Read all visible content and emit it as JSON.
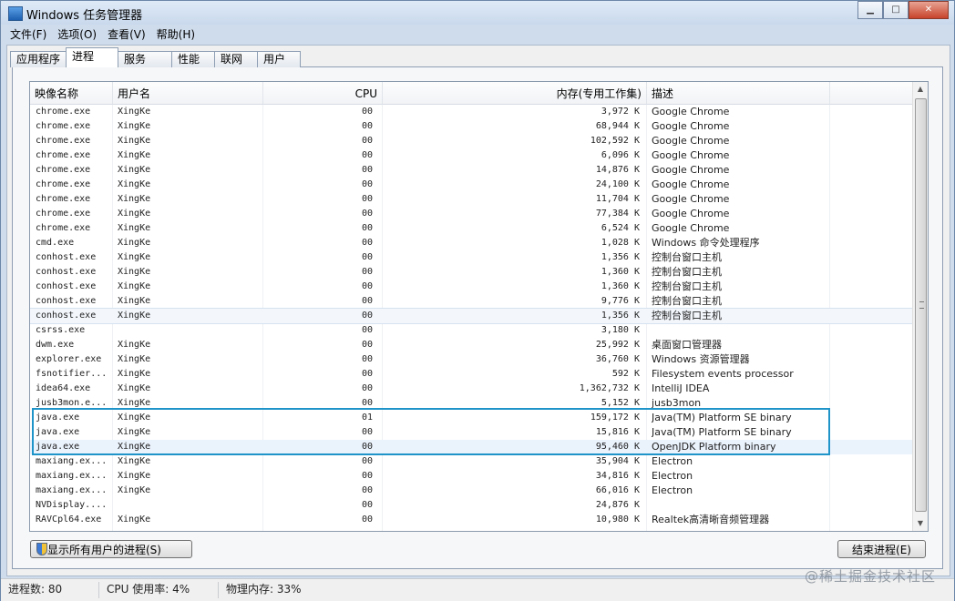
{
  "window": {
    "title": "Windows 任务管理器",
    "min_glyph": "▁",
    "max_glyph": "□",
    "close_glyph": "✕"
  },
  "menu": [
    "文件(F)",
    "选项(O)",
    "查看(V)",
    "帮助(H)"
  ],
  "tabs": [
    "应用程序",
    "进程",
    "服务",
    "性能",
    "联网",
    "用户"
  ],
  "active_tab": 1,
  "columns": {
    "name": "映像名称",
    "user": "用户名",
    "cpu": "CPU",
    "memory": "内存(专用工作集)",
    "desc": "描述"
  },
  "rows": [
    {
      "name": "chrome.exe",
      "user": "XingKe",
      "cpu": "00",
      "mem": "3,972 K",
      "desc": "Google Chrome"
    },
    {
      "name": "chrome.exe",
      "user": "XingKe",
      "cpu": "00",
      "mem": "68,944 K",
      "desc": "Google Chrome"
    },
    {
      "name": "chrome.exe",
      "user": "XingKe",
      "cpu": "00",
      "mem": "102,592 K",
      "desc": "Google Chrome"
    },
    {
      "name": "chrome.exe",
      "user": "XingKe",
      "cpu": "00",
      "mem": "6,096 K",
      "desc": "Google Chrome"
    },
    {
      "name": "chrome.exe",
      "user": "XingKe",
      "cpu": "00",
      "mem": "14,876 K",
      "desc": "Google Chrome"
    },
    {
      "name": "chrome.exe",
      "user": "XingKe",
      "cpu": "00",
      "mem": "24,100 K",
      "desc": "Google Chrome"
    },
    {
      "name": "chrome.exe",
      "user": "XingKe",
      "cpu": "00",
      "mem": "11,704 K",
      "desc": "Google Chrome"
    },
    {
      "name": "chrome.exe",
      "user": "XingKe",
      "cpu": "00",
      "mem": "77,384 K",
      "desc": "Google Chrome"
    },
    {
      "name": "chrome.exe",
      "user": "XingKe",
      "cpu": "00",
      "mem": "6,524 K",
      "desc": "Google Chrome"
    },
    {
      "name": "cmd.exe",
      "user": "XingKe",
      "cpu": "00",
      "mem": "1,028 K",
      "desc": "Windows 命令处理程序"
    },
    {
      "name": "conhost.exe",
      "user": "XingKe",
      "cpu": "00",
      "mem": "1,356 K",
      "desc": "控制台窗口主机"
    },
    {
      "name": "conhost.exe",
      "user": "XingKe",
      "cpu": "00",
      "mem": "1,360 K",
      "desc": "控制台窗口主机"
    },
    {
      "name": "conhost.exe",
      "user": "XingKe",
      "cpu": "00",
      "mem": "1,360 K",
      "desc": "控制台窗口主机"
    },
    {
      "name": "conhost.exe",
      "user": "XingKe",
      "cpu": "00",
      "mem": "9,776 K",
      "desc": "控制台窗口主机"
    },
    {
      "name": "conhost.exe",
      "user": "XingKe",
      "cpu": "00",
      "mem": "1,356 K",
      "desc": "控制台窗口主机"
    },
    {
      "name": "csrss.exe",
      "user": "",
      "cpu": "00",
      "mem": "3,180 K",
      "desc": ""
    },
    {
      "name": "dwm.exe",
      "user": "XingKe",
      "cpu": "00",
      "mem": "25,992 K",
      "desc": "桌面窗口管理器"
    },
    {
      "name": "explorer.exe",
      "user": "XingKe",
      "cpu": "00",
      "mem": "36,760 K",
      "desc": "Windows 资源管理器"
    },
    {
      "name": "fsnotifier...",
      "user": "XingKe",
      "cpu": "00",
      "mem": "592 K",
      "desc": "Filesystem events processor"
    },
    {
      "name": "idea64.exe",
      "user": "XingKe",
      "cpu": "00",
      "mem": "1,362,732 K",
      "desc": "IntelliJ IDEA"
    },
    {
      "name": "jusb3mon.e...",
      "user": "XingKe",
      "cpu": "00",
      "mem": "5,152 K",
      "desc": "jusb3mon"
    },
    {
      "name": "java.exe",
      "user": "XingKe",
      "cpu": "01",
      "mem": "159,172 K",
      "desc": "Java(TM) Platform SE binary"
    },
    {
      "name": "java.exe",
      "user": "XingKe",
      "cpu": "00",
      "mem": "15,816 K",
      "desc": "Java(TM) Platform SE binary"
    },
    {
      "name": "java.exe",
      "user": "XingKe",
      "cpu": "00",
      "mem": "95,460 K",
      "desc": "OpenJDK Platform binary"
    },
    {
      "name": "maxiang.ex...",
      "user": "XingKe",
      "cpu": "00",
      "mem": "35,904 K",
      "desc": "Electron"
    },
    {
      "name": "maxiang.ex...",
      "user": "XingKe",
      "cpu": "00",
      "mem": "34,816 K",
      "desc": "Electron"
    },
    {
      "name": "maxiang.ex...",
      "user": "XingKe",
      "cpu": "00",
      "mem": "66,016 K",
      "desc": "Electron"
    },
    {
      "name": "NVDisplay....",
      "user": "",
      "cpu": "00",
      "mem": "24,876 K",
      "desc": ""
    },
    {
      "name": "RAVCpl64.exe",
      "user": "XingKe",
      "cpu": "00",
      "mem": "10,980 K",
      "desc": "Realtek高清晰音频管理器"
    }
  ],
  "buttons": {
    "show_all": "显示所有用户的进程(S)",
    "end_process": "结束进程(E)"
  },
  "status": {
    "processes": "进程数: 80",
    "cpu": "CPU 使用率: 4%",
    "memory": "物理内存: 33%"
  },
  "watermark": "@稀土掘金技术社区"
}
